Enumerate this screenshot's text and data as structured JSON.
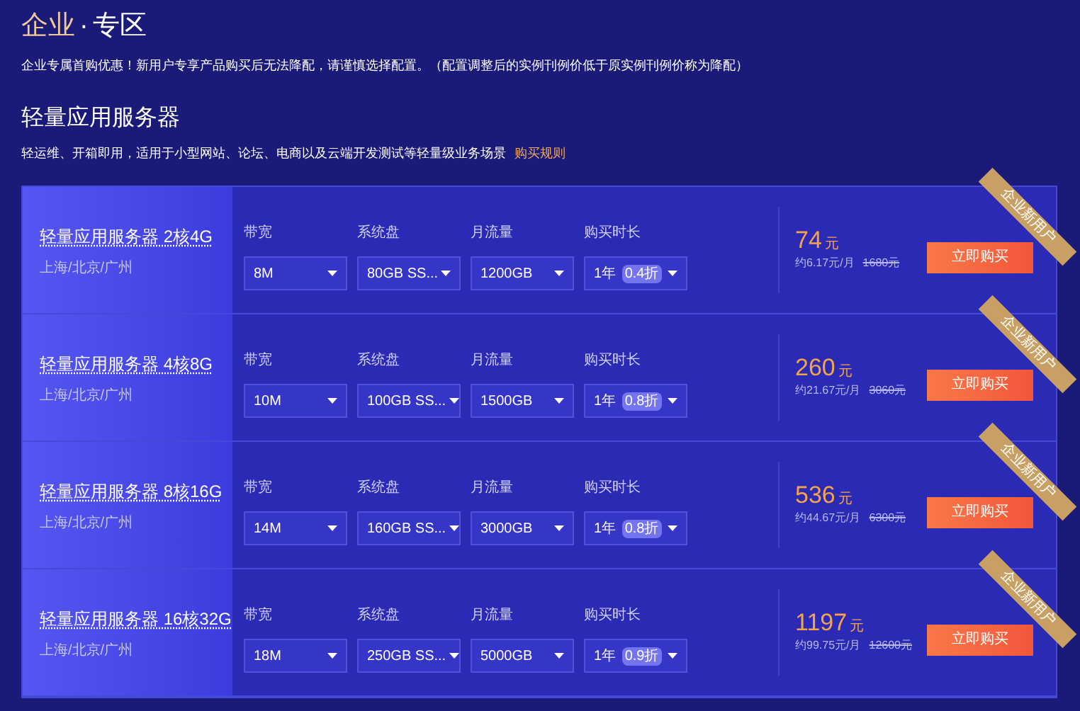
{
  "header": {
    "title_main": "企业",
    "title_sep": "·",
    "title_rest": "专区",
    "notice": "企业专属首购优惠！新用户专享产品购买后无法降配，请谨慎选择配置。（配置调整后的实例刊例价低于原实例刊例价称为降配）"
  },
  "section": {
    "title": "轻量应用服务器",
    "description": "轻运维、开箱即用，适用于小型网站、论坛、电商以及云端开发测试等轻量级业务场景",
    "rules_link": "购买规则"
  },
  "products": [
    {
      "name": "轻量应用服务器 2核4G",
      "regions": "上海/北京/广州",
      "ribbon": "企业新用户",
      "fields": [
        {
          "label": "带宽",
          "value": "8M"
        },
        {
          "label": "系统盘",
          "value": "80GB SS..."
        },
        {
          "label": "月流量",
          "value": "1200GB"
        },
        {
          "label": "购买时长",
          "value": "1年",
          "discount": "0.4折"
        }
      ],
      "price": "74",
      "unit": "元",
      "monthly": "约6.17元/月",
      "original": "1680元",
      "button": "立即购买"
    },
    {
      "name": "轻量应用服务器 4核8G",
      "regions": "上海/北京/广州",
      "ribbon": "企业新用户",
      "fields": [
        {
          "label": "带宽",
          "value": "10M"
        },
        {
          "label": "系统盘",
          "value": "100GB SS..."
        },
        {
          "label": "月流量",
          "value": "1500GB"
        },
        {
          "label": "购买时长",
          "value": "1年",
          "discount": "0.8折"
        }
      ],
      "price": "260",
      "unit": "元",
      "monthly": "约21.67元/月",
      "original": "3060元",
      "button": "立即购买"
    },
    {
      "name": "轻量应用服务器 8核16G",
      "regions": "上海/北京/广州",
      "ribbon": "企业新用户",
      "fields": [
        {
          "label": "带宽",
          "value": "14M"
        },
        {
          "label": "系统盘",
          "value": "160GB SS..."
        },
        {
          "label": "月流量",
          "value": "3000GB"
        },
        {
          "label": "购买时长",
          "value": "1年",
          "discount": "0.8折"
        }
      ],
      "price": "536",
      "unit": "元",
      "monthly": "约44.67元/月",
      "original": "6300元",
      "button": "立即购买"
    },
    {
      "name": "轻量应用服务器 16核32G",
      "regions": "上海/北京/广州",
      "ribbon": "企业新用户",
      "fields": [
        {
          "label": "带宽",
          "value": "18M"
        },
        {
          "label": "系统盘",
          "value": "250GB SS..."
        },
        {
          "label": "月流量",
          "value": "5000GB"
        },
        {
          "label": "购买时长",
          "value": "1年",
          "discount": "0.9折"
        }
      ],
      "price": "1197",
      "unit": "元",
      "monthly": "约99.75元/月",
      "original": "12600元",
      "button": "立即购买"
    }
  ]
}
